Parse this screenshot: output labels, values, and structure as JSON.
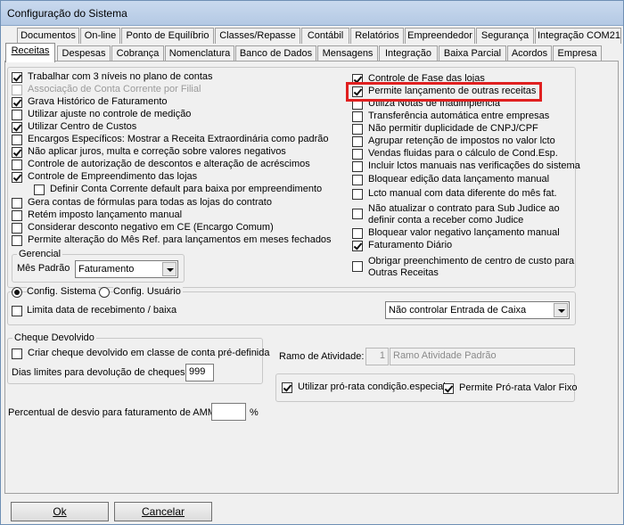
{
  "window": {
    "title": "Configuração do Sistema"
  },
  "tabs_row1": [
    "Documentos",
    "On-line",
    "Ponto de Equilíbrio",
    "Classes/Repasse",
    "Contábil",
    "Relatórios",
    "Empreendedor",
    "Segurança",
    "Integração COM21"
  ],
  "tabs_row2": [
    "Receitas",
    "Despesas",
    "Cobrança",
    "Nomenclatura",
    "Banco de Dados",
    "Mensagens",
    "Integração",
    "Baixa Parcial",
    "Acordos",
    "Empresa"
  ],
  "left_options": [
    {
      "label": "Trabalhar com 3 níveis no plano de contas",
      "checked": true,
      "disabled": false
    },
    {
      "label": "Associação de Conta Corrente por Filial",
      "checked": false,
      "disabled": true
    },
    {
      "label": "Grava Histórico de Faturamento",
      "checked": true,
      "disabled": false
    },
    {
      "label": "Utilizar ajuste no controle de medição",
      "checked": false,
      "disabled": false
    },
    {
      "label": "Utilizar Centro de Custos",
      "checked": true,
      "disabled": false
    },
    {
      "label": "Encargos Específicos: Mostrar a Receita Extraordinária como padrão",
      "checked": false,
      "disabled": false
    },
    {
      "label": "Não aplicar juros, multa e correção sobre valores negativos",
      "checked": true,
      "disabled": false
    },
    {
      "label": "Controle de autorização de descontos e alteração de acréscimos",
      "checked": false,
      "disabled": false
    },
    {
      "label": "Controle de Empreendimento das lojas",
      "checked": true,
      "disabled": false
    },
    {
      "label": "Definir Conta Corrente default para baixa por empreendimento",
      "checked": false,
      "disabled": false
    },
    {
      "label": "Gera contas de fórmulas para todas as lojas do contrato",
      "checked": false,
      "disabled": false
    },
    {
      "label": "Retém imposto lançamento manual",
      "checked": false,
      "disabled": false
    },
    {
      "label": "Considerar desconto negativo em CE (Encargo Comum)",
      "checked": false,
      "disabled": false
    },
    {
      "label": "Permite alteração do Mês Ref. para lançamentos em meses fechados",
      "checked": false,
      "disabled": false
    }
  ],
  "right_options": [
    {
      "label": "Controle de Fase das lojas",
      "checked": true
    },
    {
      "label": "Permite lançamento de outras receitas",
      "checked": true
    },
    {
      "label": "Utiliza Notas de Inadimplência",
      "checked": false
    },
    {
      "label": "Transferência automática entre empresas",
      "checked": false
    },
    {
      "label": "Não permitir duplicidade de CNPJ/CPF",
      "checked": false
    },
    {
      "label": "Agrupar retenção de impostos no valor lcto",
      "checked": false
    },
    {
      "label": "Vendas fluidas para o cálculo de Cond.Esp.",
      "checked": false
    },
    {
      "label": "Incluir lctos manuais nas verificações do sistema",
      "checked": false
    },
    {
      "label": "Bloquear edição data lançamento manual",
      "checked": false
    },
    {
      "label": "Lcto manual com data diferente do mês fat.",
      "checked": false
    },
    {
      "label": "Não atualizar o contrato para Sub Judice ao",
      "label2": "definir conta a receber como Judice",
      "checked": false
    },
    {
      "label": "Bloquear valor negativo lançamento manual",
      "checked": false
    },
    {
      "label": "Faturamento Diário",
      "checked": true
    },
    {
      "label": "Obrigar preenchimento de centro de custo para",
      "label2": "Outras Receitas",
      "checked": false
    }
  ],
  "gerencial": {
    "title": "Gerencial",
    "mes_padrao_label": "Mês Padrão",
    "mes_padrao_value": "Faturamento"
  },
  "config": {
    "radio_sistema": "Config. Sistema",
    "radio_usuario": "Config. Usuário",
    "limita_label": "Limita data de recebimento / baixa",
    "caixa_select": "Não controlar Entrada de Caixa"
  },
  "cheque": {
    "title": "Cheque Devolvido",
    "criar_label": "Criar cheque devolvido em classe de conta pré-definida",
    "dias_label": "Dias limites para devolução de cheques",
    "dias_value": "999"
  },
  "ramo": {
    "label": "Ramo de Atividade:",
    "code": "1",
    "value": "Ramo Atividade Padrão"
  },
  "prorata": {
    "utilizar_label": "Utilizar pró-rata condição.especial",
    "permite_label": "Permite Pró-rata Valor Fixo"
  },
  "desvio": {
    "label": "Percentual de desvio para faturamento de AMM",
    "value": "",
    "unit": "%"
  },
  "buttons": {
    "ok": "Ok",
    "cancel": "Cancelar"
  },
  "colors": {
    "highlight": "#e02020",
    "titlebar": "#c9d9ee"
  }
}
